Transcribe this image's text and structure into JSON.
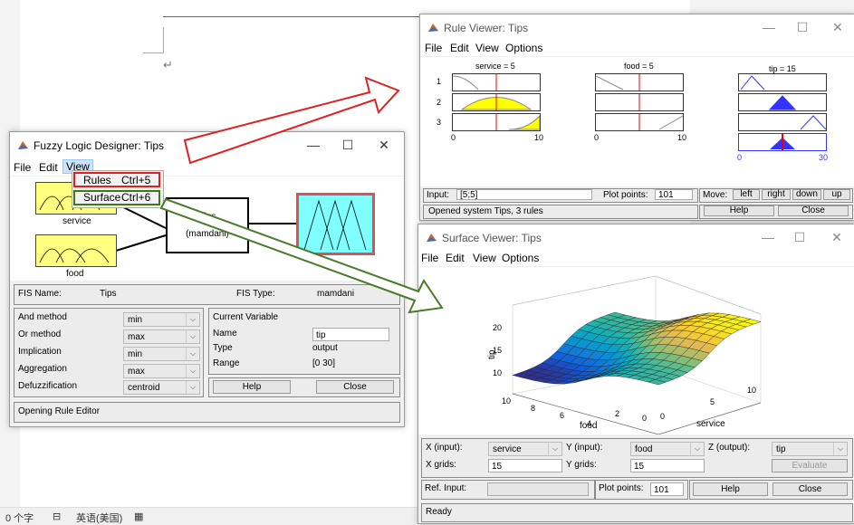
{
  "statusbar": {
    "words": "0 个字",
    "lang": "英语(美国)"
  },
  "doc": {
    "return_mark": "↵"
  },
  "designer": {
    "title": "Fuzzy Logic Designer: Tips",
    "menu": [
      "File",
      "Edit",
      "View"
    ],
    "view_menu": [
      {
        "label": "Rules",
        "shortcut": "Ctrl+5"
      },
      {
        "label": "Surface",
        "shortcut": "Ctrl+6"
      }
    ],
    "inputs": [
      "service",
      "food"
    ],
    "system_name": "Tips",
    "system_type": "(mamdani)",
    "output": "tip",
    "fis_name_label": "FIS Name:",
    "fis_name": "Tips",
    "fis_type_label": "FIS Type:",
    "fis_type": "mamdani",
    "methods": [
      {
        "label": "And method",
        "value": "min"
      },
      {
        "label": "Or method",
        "value": "max"
      },
      {
        "label": "Implication",
        "value": "min"
      },
      {
        "label": "Aggregation",
        "value": "max"
      },
      {
        "label": "Defuzzification",
        "value": "centroid"
      }
    ],
    "current_variable": {
      "heading": "Current Variable",
      "name_label": "Name",
      "name": "tip",
      "type_label": "Type",
      "type": "output",
      "range_label": "Range",
      "range": "[0 30]"
    },
    "help": "Help",
    "close": "Close",
    "status": "Opening Rule Editor"
  },
  "ruleviewer": {
    "title": "Rule Viewer: Tips",
    "menu": [
      "File",
      "Edit",
      "View",
      "Options"
    ],
    "col_titles": [
      "service = 5",
      "food = 5",
      "tip = 15"
    ],
    "rows": [
      "1",
      "2",
      "3"
    ],
    "axis_in": [
      "0",
      "10"
    ],
    "axis_out": [
      "0",
      "30"
    ],
    "input_label": "Input:",
    "input_value": "[5;5]",
    "plot_points_label": "Plot points:",
    "plot_points": "101",
    "move_label": "Move:",
    "move_buttons": [
      "left",
      "right",
      "down",
      "up"
    ],
    "status": "Opened system Tips, 3 rules",
    "help": "Help",
    "close": "Close"
  },
  "surfaceviewer": {
    "title": "Surface Viewer: Tips",
    "menu": [
      "File",
      "Edit",
      "View",
      "Options"
    ],
    "plot": {
      "zlabel": "tip",
      "xlabel": "food",
      "ylabel": "service",
      "z_ticks": [
        "10",
        "15",
        "20"
      ],
      "food_ticks": [
        "10",
        "8",
        "6",
        "4",
        "2",
        "0"
      ],
      "service_ticks": [
        "0",
        "5",
        "10"
      ]
    },
    "x_input_label": "X (input):",
    "x_input": "service",
    "y_input_label": "Y (input):",
    "y_input": "food",
    "z_output_label": "Z (output):",
    "z_output": "tip",
    "x_grids_label": "X grids:",
    "x_grids": "15",
    "y_grids_label": "Y grids:",
    "y_grids": "15",
    "evaluate": "Evaluate",
    "ref_input_label": "Ref. Input:",
    "plot_points_label": "Plot points:",
    "plot_points": "101",
    "help": "Help",
    "close": "Close",
    "status": "Ready"
  },
  "annotation_colors": {
    "rules_box": "#e02020",
    "surface_box": "#3a7a1a",
    "output_box": "#e05050",
    "arrow_red": "#e02020",
    "arrow_green": "#4a7a2a"
  }
}
